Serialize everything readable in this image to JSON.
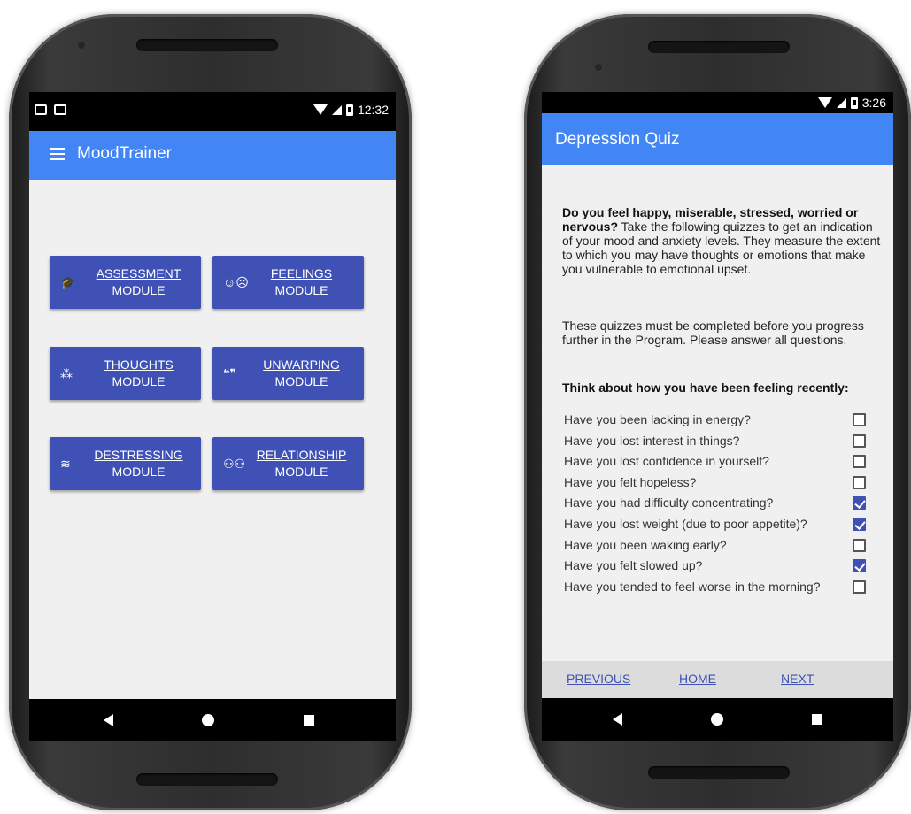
{
  "left_phone": {
    "status_time": "12:32",
    "app_title": "MoodTrainer",
    "modules": [
      {
        "icon": "graduation-cap-icon",
        "glyph": "🎓",
        "line1": "ASSESSMENT",
        "line2": "MODULE"
      },
      {
        "icon": "faces-icon",
        "glyph": "☺☹",
        "line1": "FEELINGS",
        "line2": "MODULE"
      },
      {
        "icon": "thinking-person-icon",
        "glyph": "⁂",
        "line1": "THOUGHTS",
        "line2": "MODULE"
      },
      {
        "icon": "people-speech-icon",
        "glyph": "❝❞",
        "line1": "UNWARPING",
        "line2": "MODULE"
      },
      {
        "icon": "relax-icon",
        "glyph": "≋",
        "line1": "DESTRESSING",
        "line2": "MODULE"
      },
      {
        "icon": "group-icon",
        "glyph": "⚇⚇",
        "line1": "RELATIONSHIP",
        "line2": "MODULE"
      }
    ]
  },
  "right_phone": {
    "status_time": "3:26",
    "app_title": "Depression Quiz",
    "intro_bold": "Do you feel happy, miserable, stressed, worried or nervous?",
    "intro_rest": " Take the following quizzes to get an indication of your mood and anxiety levels. They measure the extent to which you may have thoughts or emotions that make you vulnerable to emotional upset.",
    "instructions": "These quizzes must be completed before you progress further in the Program. Please answer all questions.",
    "prompt": "Think about how you have been feeling recently:",
    "questions": [
      {
        "text": "Have you been lacking in energy?",
        "checked": false
      },
      {
        "text": "Have you lost interest in things?",
        "checked": false
      },
      {
        "text": "Have you lost confidence in yourself?",
        "checked": false
      },
      {
        "text": "Have you felt hopeless?",
        "checked": false
      },
      {
        "text": "Have you had difficulty concentrating?",
        "checked": true
      },
      {
        "text": "Have you lost weight (due to poor appetite)?",
        "checked": true
      },
      {
        "text": "Have you been waking early?",
        "checked": false
      },
      {
        "text": "Have you felt slowed up?",
        "checked": true
      },
      {
        "text": "Have you tended to feel worse in the morning?",
        "checked": false
      }
    ],
    "nav": {
      "previous": "PREVIOUS",
      "home": "HOME",
      "next": "NEXT"
    }
  },
  "colors": {
    "appbar": "#4285f4",
    "button": "#3f51b5",
    "screen_bg": "#f0f0f0"
  }
}
